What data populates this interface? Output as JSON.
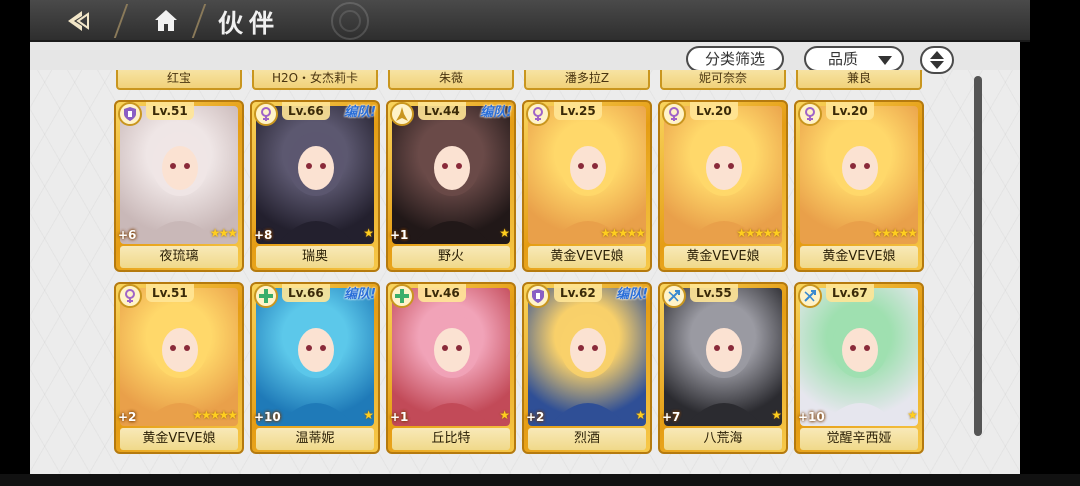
{
  "header": {
    "title": "伙伴"
  },
  "toolbar": {
    "filter_label": "分类筛选",
    "quality_label": "品质"
  },
  "partial_row": [
    "红宝",
    "H2O・女杰莉卡",
    "朱薇",
    "潘多拉Z",
    "妮可奈奈",
    "兼良"
  ],
  "partners": [
    {
      "name": "夜琉璃",
      "level": "Lv.51",
      "plus": "+6",
      "stars": 3,
      "team": "",
      "class": "shield-icon",
      "colors": [
        "#efe6e6",
        "#c9b8b8"
      ]
    },
    {
      "name": "瑞奥",
      "level": "Lv.66",
      "plus": "+8",
      "stars": 1,
      "team": "编队!",
      "class": "flower-icon",
      "colors": [
        "#5c5870",
        "#23202e"
      ]
    },
    {
      "name": "野火",
      "level": "Lv.44",
      "plus": "+1",
      "stars": 1,
      "team": "编队!",
      "class": "flame-icon",
      "colors": [
        "#6a4a48",
        "#211818"
      ]
    },
    {
      "name": "黄金VEVE娘",
      "level": "Lv.25",
      "plus": "",
      "stars": 5,
      "team": "",
      "class": "flower-icon",
      "colors": [
        "#ffd86a",
        "#e9a04a"
      ]
    },
    {
      "name": "黄金VEVE娘",
      "level": "Lv.20",
      "plus": "",
      "stars": 5,
      "team": "",
      "class": "flower-icon",
      "colors": [
        "#ffd86a",
        "#e9a04a"
      ]
    },
    {
      "name": "黄金VEVE娘",
      "level": "Lv.20",
      "plus": "",
      "stars": 5,
      "team": "",
      "class": "flower-icon",
      "colors": [
        "#ffd86a",
        "#e9a04a"
      ]
    },
    {
      "name": "黄金VEVE娘",
      "level": "Lv.51",
      "plus": "+2",
      "stars": 5,
      "team": "",
      "class": "flower-icon",
      "colors": [
        "#ffd86a",
        "#e9a04a"
      ]
    },
    {
      "name": "温蒂妮",
      "level": "Lv.66",
      "plus": "+10",
      "stars": 1,
      "team": "编队!",
      "class": "cross-icon",
      "colors": [
        "#5cc8ea",
        "#1f7ab8"
      ]
    },
    {
      "name": "丘比特",
      "level": "Lv.46",
      "plus": "+1",
      "stars": 1,
      "team": "",
      "class": "cross-icon",
      "colors": [
        "#f1a3b8",
        "#c24a58"
      ]
    },
    {
      "name": "烈酒",
      "level": "Lv.62",
      "plus": "+2",
      "stars": 1,
      "team": "编队!",
      "class": "shield-icon",
      "colors": [
        "#f8d06a",
        "#2f4f96"
      ]
    },
    {
      "name": "八荒海",
      "level": "Lv.55",
      "plus": "+7",
      "stars": 1,
      "team": "",
      "class": "bow-icon",
      "colors": [
        "#9a9aa2",
        "#2b2b30"
      ]
    },
    {
      "name": "觉醒辛西娅",
      "level": "Lv.67",
      "plus": "+10",
      "stars": 1,
      "team": "",
      "class": "bow-icon",
      "colors": [
        "#9fe0b0",
        "#e6e6ee"
      ]
    }
  ]
}
